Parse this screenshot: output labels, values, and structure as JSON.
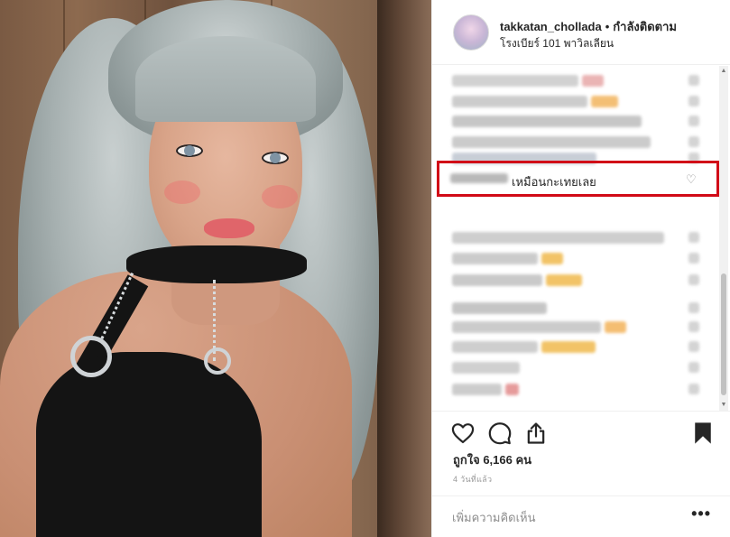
{
  "post": {
    "username": "takkatan_chollada",
    "separator": "•",
    "follow_status": "กำลังติดตาม",
    "location": "โรงเบียร์ 101 พาวิลเลียน"
  },
  "highlighted_comment": {
    "text": "เหมือนกะเทยเลย",
    "heart_icon": "♡"
  },
  "blurred_comments": [
    {
      "color": "#c9c9c9",
      "accent": "#e7a7a7"
    },
    {
      "color": "#c4c4c4",
      "accent": "#f2b45e"
    },
    {
      "color": "#bdbdbd",
      "accent": ""
    },
    {
      "color": "#c2c2c2",
      "accent": ""
    },
    {
      "color": "#bfc6d0",
      "accent": ""
    },
    {
      "color": "#c6c6c6",
      "accent": ""
    },
    {
      "color": "#c3c3c3",
      "accent": "#f0b94d"
    },
    {
      "color": "#c0c0c0",
      "accent": "#f0b94d"
    },
    {
      "color": "#bcbcbc",
      "accent": ""
    },
    {
      "color": "#c3c3c3",
      "accent": "#f3b35a"
    },
    {
      "color": "#c6c6c6",
      "accent": "#f0b94d"
    },
    {
      "color": "#c8c8c8",
      "accent": ""
    },
    {
      "color": "#c4c4c4",
      "accent": "#e28a8a"
    }
  ],
  "actions": {
    "like_icon": "heart-outline",
    "comment_icon": "speech-bubble",
    "share_icon": "share-arrow",
    "save_icon": "bookmark-filled"
  },
  "likes_text": "ถูกใจ 6,166 คน",
  "timestamp": "4 วันที่แล้ว",
  "add_comment_placeholder": "เพิ่มความคิดเห็น",
  "more_label": "•••"
}
